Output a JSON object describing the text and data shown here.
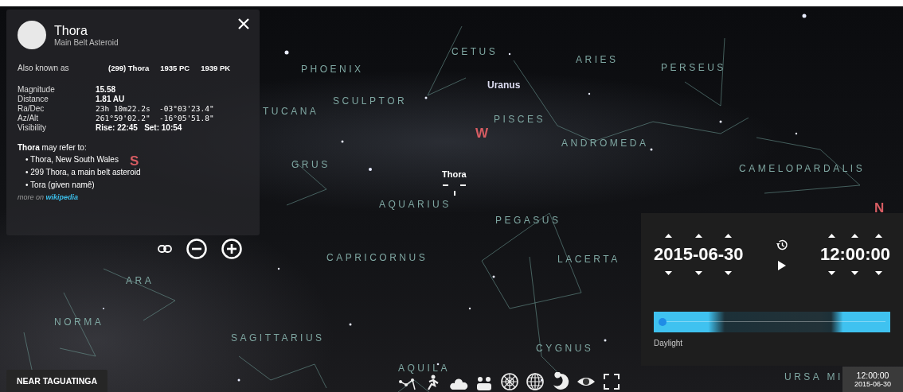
{
  "info_panel": {
    "title": "Thora",
    "subtitle": "Main Belt Asteroid",
    "also_known_as": {
      "label": "Also known as",
      "names": [
        "(299) Thora",
        "1935 PC",
        "1939 PK"
      ]
    },
    "properties": [
      {
        "label": "Magnitude",
        "value": "15.58",
        "kind": "text"
      },
      {
        "label": "Distance",
        "value": "1.81 AU",
        "kind": "text"
      },
      {
        "label": "Ra/Dec",
        "value": "23h 10m22.2s  -03°03'23.4\"",
        "kind": "mono"
      },
      {
        "label": "Az/Alt",
        "value": "261°59'02.2\"  -16°05'51.8\"",
        "kind": "mono"
      },
      {
        "label": "Visibility",
        "value": "Rise: 22:45   Set: 10:54",
        "kind": "text"
      }
    ],
    "refer_intro": "**Thora** may refer to:",
    "refer_items": [
      "• Thora, New South Wales",
      "• 299 Thora, a main belt asteroid",
      "• Tora (given namê)"
    ],
    "more_on": {
      "prefix": "more on",
      "link": "wikipedia"
    }
  },
  "sky": {
    "labels": [
      {
        "text": "PHOENIX",
        "kind": "constellation"
      },
      {
        "text": "CETUS",
        "kind": "constellation"
      },
      {
        "text": "ARIES",
        "kind": "constellation"
      },
      {
        "text": "PERSEUS",
        "kind": "constellation"
      },
      {
        "text": "SCULPTOR",
        "kind": "constellation"
      },
      {
        "text": "Uranus",
        "kind": "planet"
      },
      {
        "text": "TUCANA",
        "kind": "constellation"
      },
      {
        "text": "PISCES",
        "kind": "constellation"
      },
      {
        "text": "W",
        "kind": "cardinal"
      },
      {
        "text": "ANDROMEDA",
        "kind": "constellation"
      },
      {
        "text": "S",
        "kind": "cardinal"
      },
      {
        "text": "GRUS",
        "kind": "constellation"
      },
      {
        "text": "CAMELOPARDALIS",
        "kind": "constellation"
      },
      {
        "text": "Thora",
        "kind": "selected"
      },
      {
        "text": "AQUARIUS",
        "kind": "constellation"
      },
      {
        "text": "N",
        "kind": "cardinal"
      },
      {
        "text": "PEGASUS",
        "kind": "constellation"
      },
      {
        "text": "CAPRICORNUS",
        "kind": "constellation"
      },
      {
        "text": "LACERTA",
        "kind": "constellation"
      },
      {
        "text": "ARA",
        "kind": "constellation"
      },
      {
        "text": "NORMA",
        "kind": "constellation"
      },
      {
        "text": "SAGITTARIUS",
        "kind": "constellation"
      },
      {
        "text": "CYGNUS",
        "kind": "constellation"
      },
      {
        "text": "AQUILA",
        "kind": "constellation"
      },
      {
        "text": "URSA MI",
        "kind": "constellation"
      }
    ]
  },
  "time_panel": {
    "date": "2015-06-30",
    "time": "12:00:00",
    "slider_label": "Daylight",
    "level": 0.02
  },
  "location": "NEAR TAGUATINGA",
  "clock": {
    "time": "12:00:00",
    "date": "2015-06-30"
  }
}
